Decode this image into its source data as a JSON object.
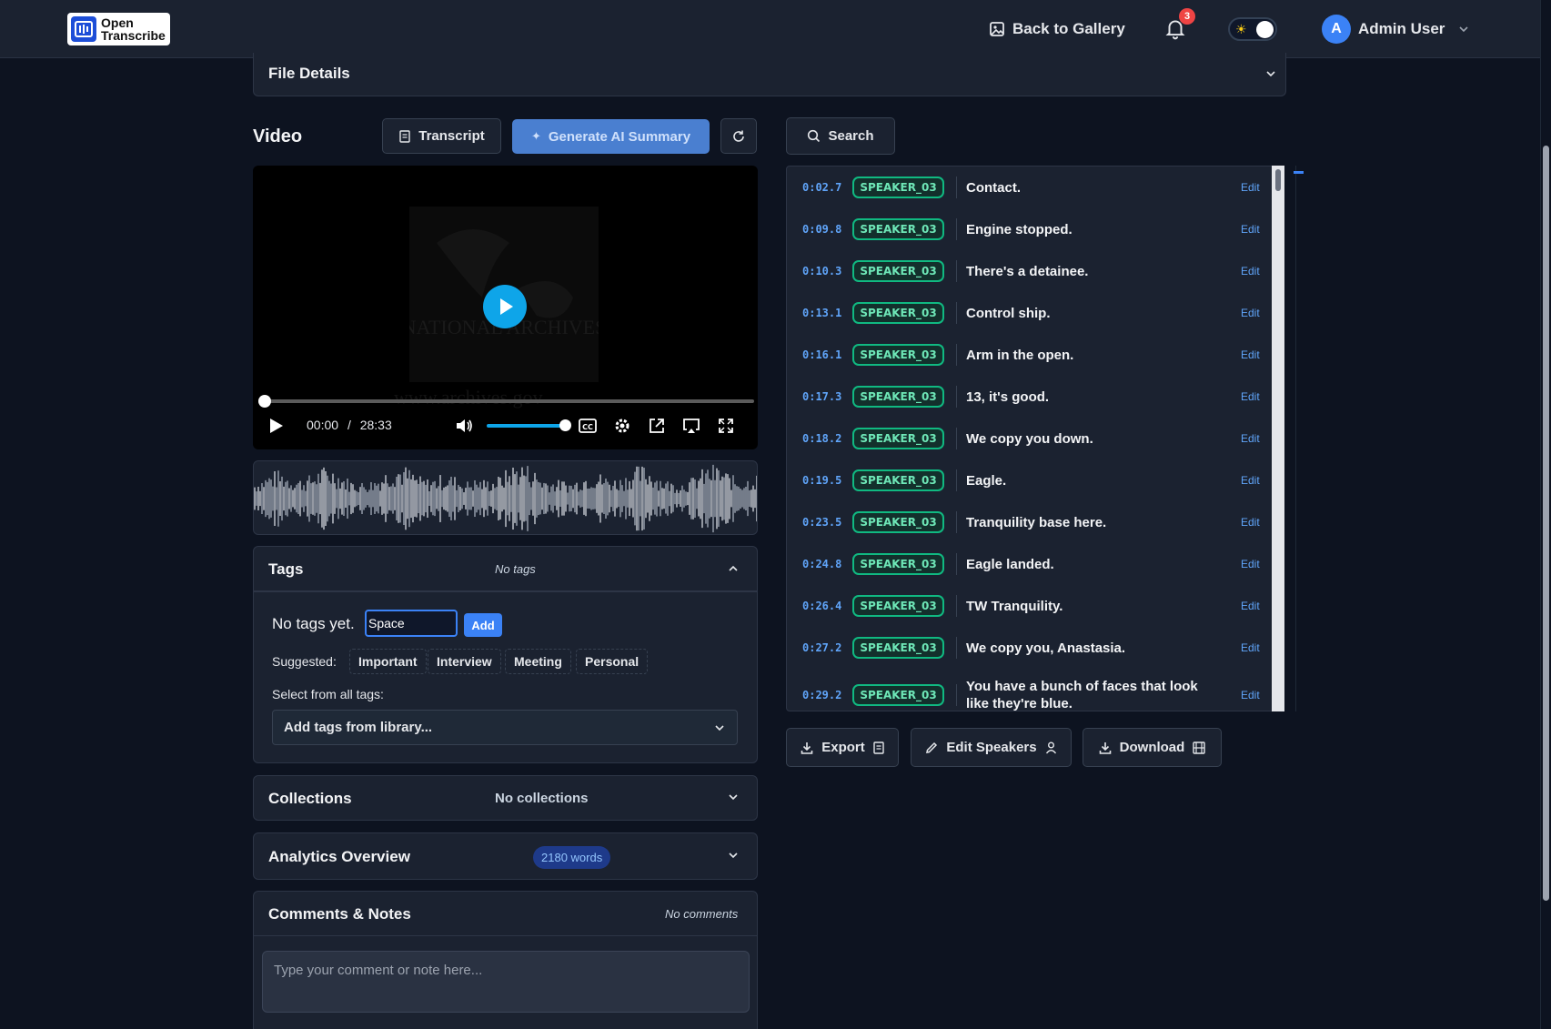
{
  "header": {
    "logo_line1": "Open",
    "logo_line2": "Transcribe",
    "back_to_gallery": "Back to Gallery",
    "notification_count": "3",
    "user_initial": "A",
    "user_name": "Admin User",
    "theme_icon": "sun-icon"
  },
  "file_details": {
    "title": "File Details"
  },
  "media": {
    "heading": "Video",
    "transcript_button": "Transcript",
    "ai_summary_button": "Generate AI Summary",
    "current_time": "00:00",
    "time_separator": "/",
    "duration": "28:33",
    "progress_fraction": 0,
    "volume_fraction": 1.0,
    "poster_watermark": "www.archives.gov",
    "poster_text": "NATIONAL ARCHIVES"
  },
  "tags": {
    "title": "Tags",
    "status": "No tags",
    "empty_text": "No tags yet.",
    "input_value": "Space",
    "add_button": "Add",
    "suggested_label": "Suggested:",
    "suggested": [
      "Important",
      "Interview",
      "Meeting",
      "Personal"
    ],
    "select_all_label": "Select from all tags:",
    "library_select": "Add tags from library..."
  },
  "collections": {
    "title": "Collections",
    "status": "No collections"
  },
  "analytics": {
    "title": "Analytics Overview",
    "badge": "2180 words"
  },
  "comments": {
    "title": "Comments & Notes",
    "status": "No comments",
    "placeholder": "Type your comment or note here..."
  },
  "transcript": {
    "search_label": "Search",
    "edit_label": "Edit",
    "segments": [
      {
        "time": "0:02.7",
        "speaker": "SPEAKER_03",
        "text": "Contact."
      },
      {
        "time": "0:09.8",
        "speaker": "SPEAKER_03",
        "text": "Engine stopped."
      },
      {
        "time": "0:10.3",
        "speaker": "SPEAKER_03",
        "text": "There's a detainee."
      },
      {
        "time": "0:13.1",
        "speaker": "SPEAKER_03",
        "text": "Control ship."
      },
      {
        "time": "0:16.1",
        "speaker": "SPEAKER_03",
        "text": "Arm in the open."
      },
      {
        "time": "0:17.3",
        "speaker": "SPEAKER_03",
        "text": "13, it's good."
      },
      {
        "time": "0:18.2",
        "speaker": "SPEAKER_03",
        "text": "We copy you down."
      },
      {
        "time": "0:19.5",
        "speaker": "SPEAKER_03",
        "text": "Eagle."
      },
      {
        "time": "0:23.5",
        "speaker": "SPEAKER_03",
        "text": "Tranquility base here."
      },
      {
        "time": "0:24.8",
        "speaker": "SPEAKER_03",
        "text": "Eagle landed."
      },
      {
        "time": "0:26.4",
        "speaker": "SPEAKER_03",
        "text": "TW Tranquility."
      },
      {
        "time": "0:27.2",
        "speaker": "SPEAKER_03",
        "text": "We copy you, Anastasia."
      },
      {
        "time": "0:29.2",
        "speaker": "SPEAKER_03",
        "text": "You have a bunch of faces that look like they're blue."
      }
    ]
  },
  "actions": {
    "export": "Export",
    "edit_speakers": "Edit Speakers",
    "download": "Download"
  },
  "colors": {
    "background": "#0d1320",
    "panel": "#1b2230",
    "accent": "#3b82f6",
    "speaker_green": "#10b981",
    "timestamp_blue": "#60a5fa"
  }
}
